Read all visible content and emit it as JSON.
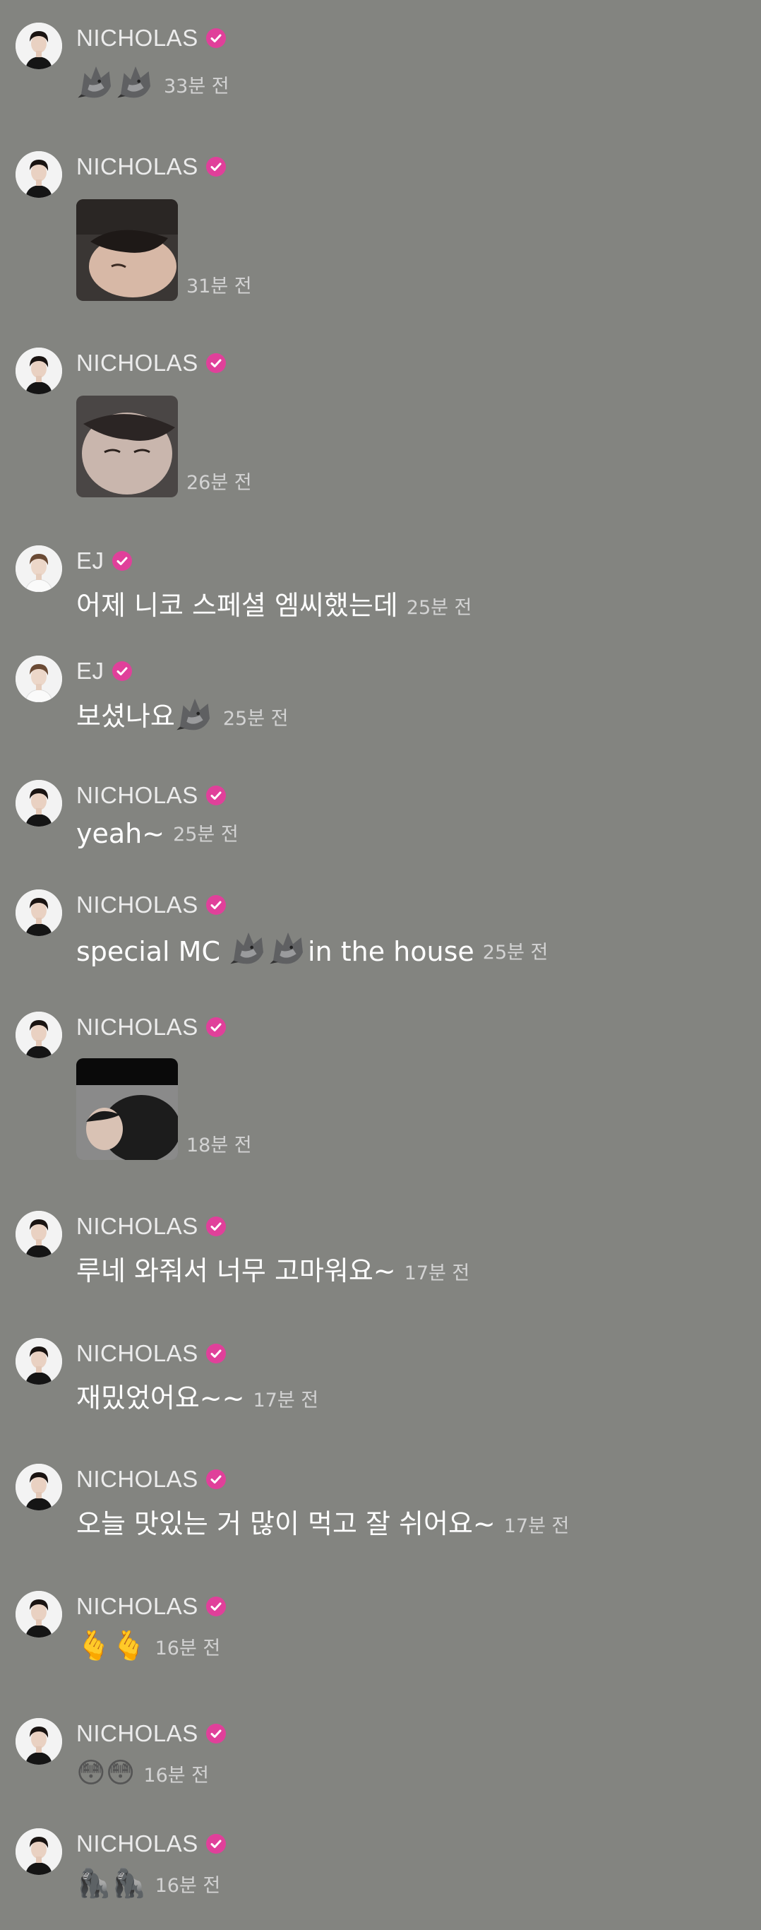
{
  "messages": [
    {
      "author": "NICHOLAS",
      "type": "emoji",
      "text": "🐺🐺",
      "time": "33분 전"
    },
    {
      "author": "NICHOLAS",
      "type": "photo",
      "time": "31분 전"
    },
    {
      "author": "NICHOLAS",
      "type": "photo",
      "time": "26분 전"
    },
    {
      "author": "EJ",
      "type": "text",
      "text": "어제 니코 스페셜 엠씨했는데",
      "time": "25분 전"
    },
    {
      "author": "EJ",
      "type": "text",
      "text": "보셨나요",
      "time": "25분 전"
    },
    {
      "author": "NICHOLAS",
      "type": "text",
      "text": "yeah~",
      "time": "25분 전"
    },
    {
      "author": "NICHOLAS",
      "type": "text",
      "text": "special MC",
      "text2": "in the house",
      "time": "25분 전"
    },
    {
      "author": "NICHOLAS",
      "type": "photo",
      "time": "18분 전"
    },
    {
      "author": "NICHOLAS",
      "type": "text",
      "text": "루네 와줘서 너무 고마워요~",
      "time": "17분 전"
    },
    {
      "author": "NICHOLAS",
      "type": "text",
      "text": "재밌었어요~~",
      "time": "17분 전"
    },
    {
      "author": "NICHOLAS",
      "type": "text",
      "text": "오늘 맛있는 거 많이 먹고 잘 쉬어요~",
      "time": "17분 전"
    },
    {
      "author": "NICHOLAS",
      "type": "emoji",
      "text": "🫰🫰",
      "time": "16분 전"
    },
    {
      "author": "NICHOLAS",
      "type": "emoji",
      "text": "😳😳",
      "time": "16분 전"
    },
    {
      "author": "NICHOLAS",
      "type": "emoji",
      "text": "🦍🦍",
      "time": "16분 전"
    }
  ],
  "icons": {
    "badge": "verified-badge-icon",
    "wolf": "wolf-emoji-icon"
  },
  "colors": {
    "background": "#838480",
    "badge": "#e0409a"
  }
}
